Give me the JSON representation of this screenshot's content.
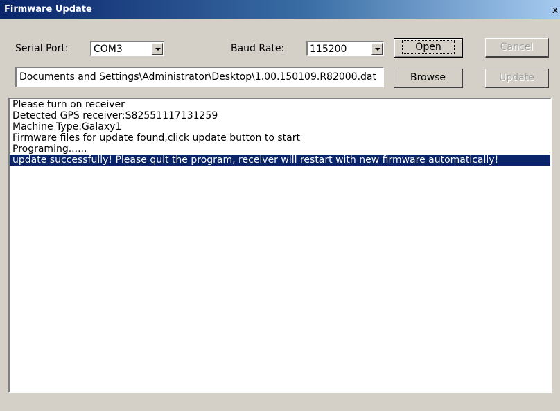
{
  "window": {
    "title": "Firmware Update",
    "close_glyph": "x"
  },
  "serial_port": {
    "label": "Serial Port:",
    "value": "COM3"
  },
  "baud_rate": {
    "label": "Baud Rate:",
    "value": "115200"
  },
  "buttons": {
    "open": "Open",
    "cancel": "Cancel",
    "browse": "Browse",
    "update": "Update"
  },
  "file_path": {
    "value": "Documents and Settings\\Administrator\\Desktop\\1.00.150109.R82000.dat"
  },
  "log": {
    "lines": [
      "Please turn on receiver",
      "Detected GPS receiver:S82551117131259",
      "Machine Type:Galaxy1",
      "Firmware files for update found,click update button to start",
      "Programing......",
      "update successfully! Please quit the program, receiver will restart with new firmware automatically!"
    ],
    "selected_index": 5
  },
  "colors": {
    "title_bar": "#0a246a",
    "selection": "#0a246a",
    "window_bg": "#d4d0c8"
  }
}
